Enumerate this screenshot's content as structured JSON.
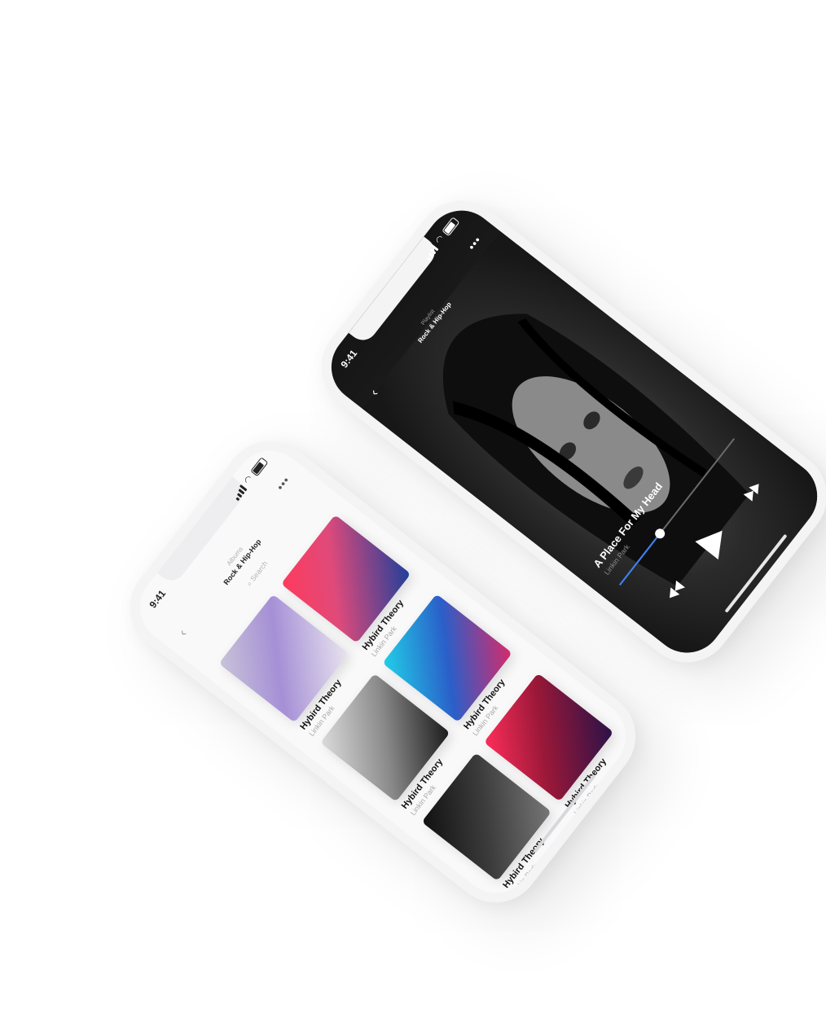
{
  "player": {
    "status_time": "9:41",
    "header_sub": "Playlist",
    "header_title": "Rock & Hip-Hop",
    "track_title": "A Place For My Head",
    "track_artist": "Linkin Park",
    "progress": 0.35,
    "icons": [
      "back-icon",
      "more-icon",
      "previous-icon",
      "play-icon",
      "next-icon"
    ]
  },
  "albums": {
    "status_time": "9:41",
    "header_sub": "Albums",
    "header_title": "Rock & Hip-Hop",
    "search_placeholder": "Search",
    "items": [
      {
        "title": "Hybird Theory",
        "artist": "Linkin Park"
      },
      {
        "title": "Hybird Theory",
        "artist": "Linkin Park"
      },
      {
        "title": "Hybird Theory",
        "artist": "Linkin Park"
      },
      {
        "title": "Hybird Theory",
        "artist": "Linkin Park"
      },
      {
        "title": "Hybird Theory",
        "artist": "Linkin Park"
      },
      {
        "title": "Hybird Theory",
        "artist": "Linkin Park"
      }
    ]
  },
  "colors": {
    "accent": "#3b82f6",
    "player_bg": "#1b1b1b",
    "albums_bg": "#f9f9fa"
  }
}
